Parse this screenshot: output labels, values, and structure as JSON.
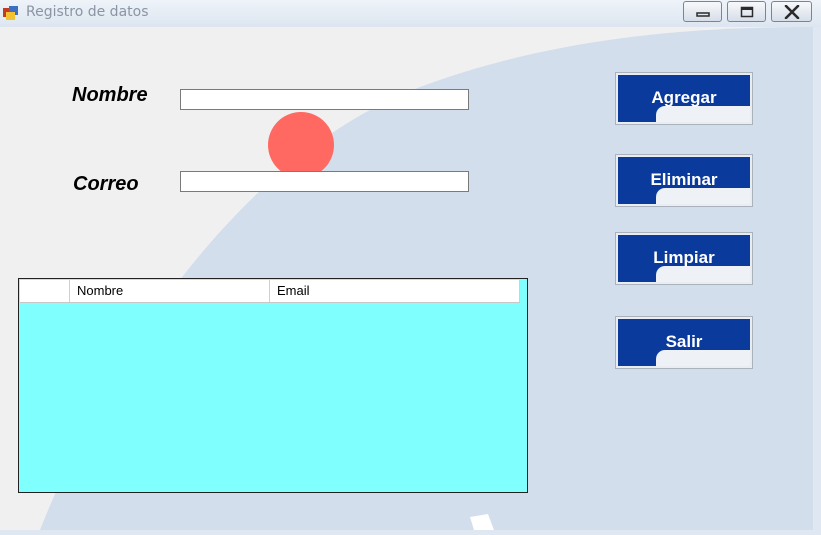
{
  "window": {
    "title": "Registro de datos",
    "icons": {
      "app": "form-icon",
      "minimize": "minimize-icon",
      "maximize": "maximize-icon",
      "close": "close-icon"
    }
  },
  "form": {
    "nombre_label": "Nombre",
    "nombre_value": "",
    "correo_label": "Correo",
    "correo_value": ""
  },
  "grid": {
    "columns": [
      "",
      "Nombre",
      "Email"
    ],
    "rows": []
  },
  "buttons": {
    "agregar": "Agregar",
    "eliminar": "Eliminar",
    "limpiar": "Limpiar",
    "salir": "Salir"
  },
  "colors": {
    "button_fill": "#0a3a9b",
    "grid_background": "#80ffff",
    "circle": "#ff6961",
    "background_shape": "#d2deec"
  }
}
